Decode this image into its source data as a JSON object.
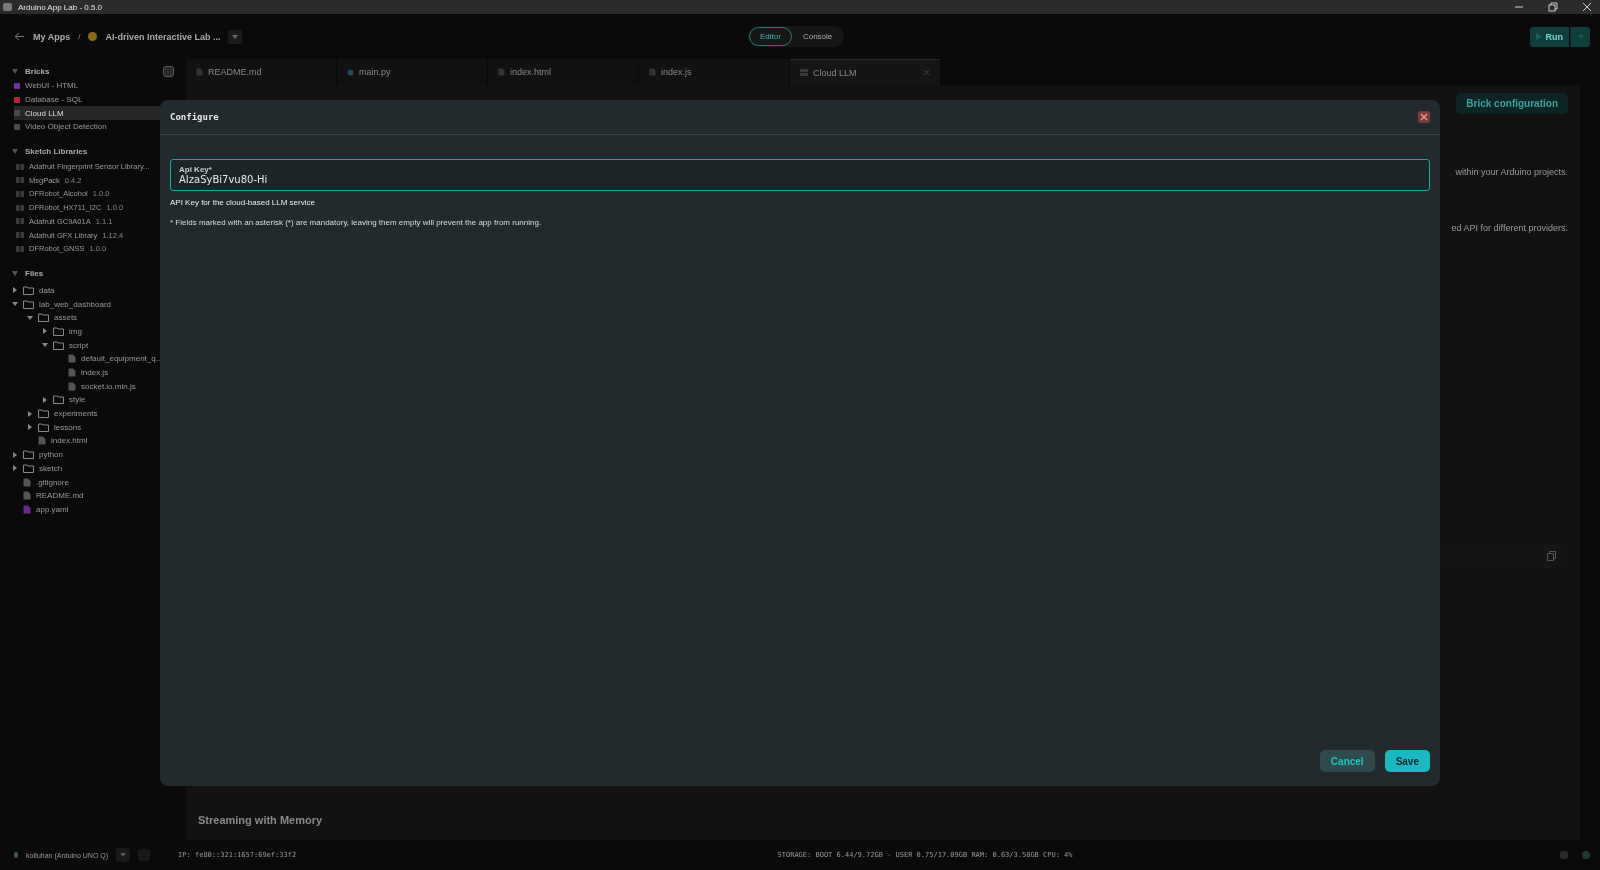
{
  "window": {
    "title": "Arduino App Lab - 0.5.0"
  },
  "topbar": {
    "back": "My Apps",
    "separator": "/",
    "app_name": "AI-driven Interactive Lab ...",
    "modes": [
      {
        "label": "Editor",
        "selected": true
      },
      {
        "label": "Console",
        "selected": false
      }
    ],
    "run": "Run"
  },
  "sidebar": {
    "bricks": {
      "title": "Bricks",
      "items": [
        {
          "name": "WebUI - HTML",
          "color": "#7b2fa8",
          "selected": false
        },
        {
          "name": "Database - SQL",
          "color": "#b0243a",
          "selected": false
        },
        {
          "name": "Cloud LLM",
          "color": "#4a4a4a",
          "selected": true
        },
        {
          "name": "Video Object Detection",
          "color": "#4a4a4a",
          "selected": false
        }
      ]
    },
    "libraries": {
      "title": "Sketch Libraries",
      "items": [
        {
          "name": "Adafruit Fingerprint Sensor Library..."
        },
        {
          "name": "MsgPack",
          "version": "0.4.2"
        },
        {
          "name": "DFRobot_Alcohol",
          "version": "1.0.0"
        },
        {
          "name": "DFRobot_HX711_I2C",
          "version": "1.0.0"
        },
        {
          "name": "Adafruit GC9A01A",
          "version": "1.1.1"
        },
        {
          "name": "Adafruit GFX Library",
          "version": "1.12.4"
        },
        {
          "name": "DFRobot_GNSS",
          "version": "1.0.0"
        }
      ]
    },
    "files": {
      "title": "Files",
      "items": [
        {
          "name": "data",
          "kind": "folder",
          "expanded": false
        },
        {
          "name": "lab_web_dashboard",
          "kind": "folder",
          "expanded": true,
          "children": [
            {
              "name": "assets",
              "kind": "folder",
              "expanded": true,
              "children": [
                {
                  "name": "img",
                  "kind": "folder",
                  "expanded": false
                },
                {
                  "name": "script",
                  "kind": "folder",
                  "expanded": true,
                  "children": [
                    {
                      "name": "default_equipment_q...",
                      "kind": "file"
                    },
                    {
                      "name": "index.js",
                      "kind": "file"
                    },
                    {
                      "name": "socket.io.min.js",
                      "kind": "file"
                    }
                  ]
                },
                {
                  "name": "style",
                  "kind": "folder",
                  "expanded": false
                }
              ]
            },
            {
              "name": "experiments",
              "kind": "folder",
              "expanded": false
            },
            {
              "name": "lessons",
              "kind": "folder",
              "expanded": false
            },
            {
              "name": "index.html",
              "kind": "file"
            }
          ]
        },
        {
          "name": "python",
          "kind": "folder",
          "expanded": false
        },
        {
          "name": "sketch",
          "kind": "folder",
          "expanded": false
        },
        {
          "name": ".gitignore",
          "kind": "file"
        },
        {
          "name": "README.md",
          "kind": "file"
        },
        {
          "name": "app.yaml",
          "kind": "yaml"
        }
      ]
    }
  },
  "tabs": [
    {
      "label": "README.md",
      "kind": "file",
      "selected": false
    },
    {
      "label": "main.py",
      "kind": "python",
      "selected": false
    },
    {
      "label": "index.html",
      "kind": "file",
      "selected": false
    },
    {
      "label": "index.js",
      "kind": "file",
      "selected": false
    },
    {
      "label": "Cloud LLM",
      "kind": "brick",
      "selected": true
    }
  ],
  "content": {
    "config_button": "Brick configuration",
    "line_1": "within your Arduino projects.",
    "line_2": "ed API for different providers.",
    "heading": "Streaming with Memory"
  },
  "dialog": {
    "title": "Configure",
    "field": {
      "label": "Api Key*",
      "value": "AIzaSyBi7vu80-Hi"
    },
    "help": "API Key for the cloud-based LLM service",
    "note": "* Fields marked with an asterisk (*) are mandatory, leaving them empty will prevent the app from running.",
    "buttons": [
      {
        "label": "Cancel",
        "kind": "secondary"
      },
      {
        "label": "Save",
        "kind": "primary"
      }
    ]
  },
  "status_bar": {
    "board": "kotluhan (Arduino UNO Q)",
    "ip": "IP: fe80::321:1657:69ef:33f2",
    "stats": "STORAGE: BOOT 6.44/9.72GB - USER 0.75/17.09GB  RAM: 0.63/3.58GB  CPU: 4%"
  }
}
